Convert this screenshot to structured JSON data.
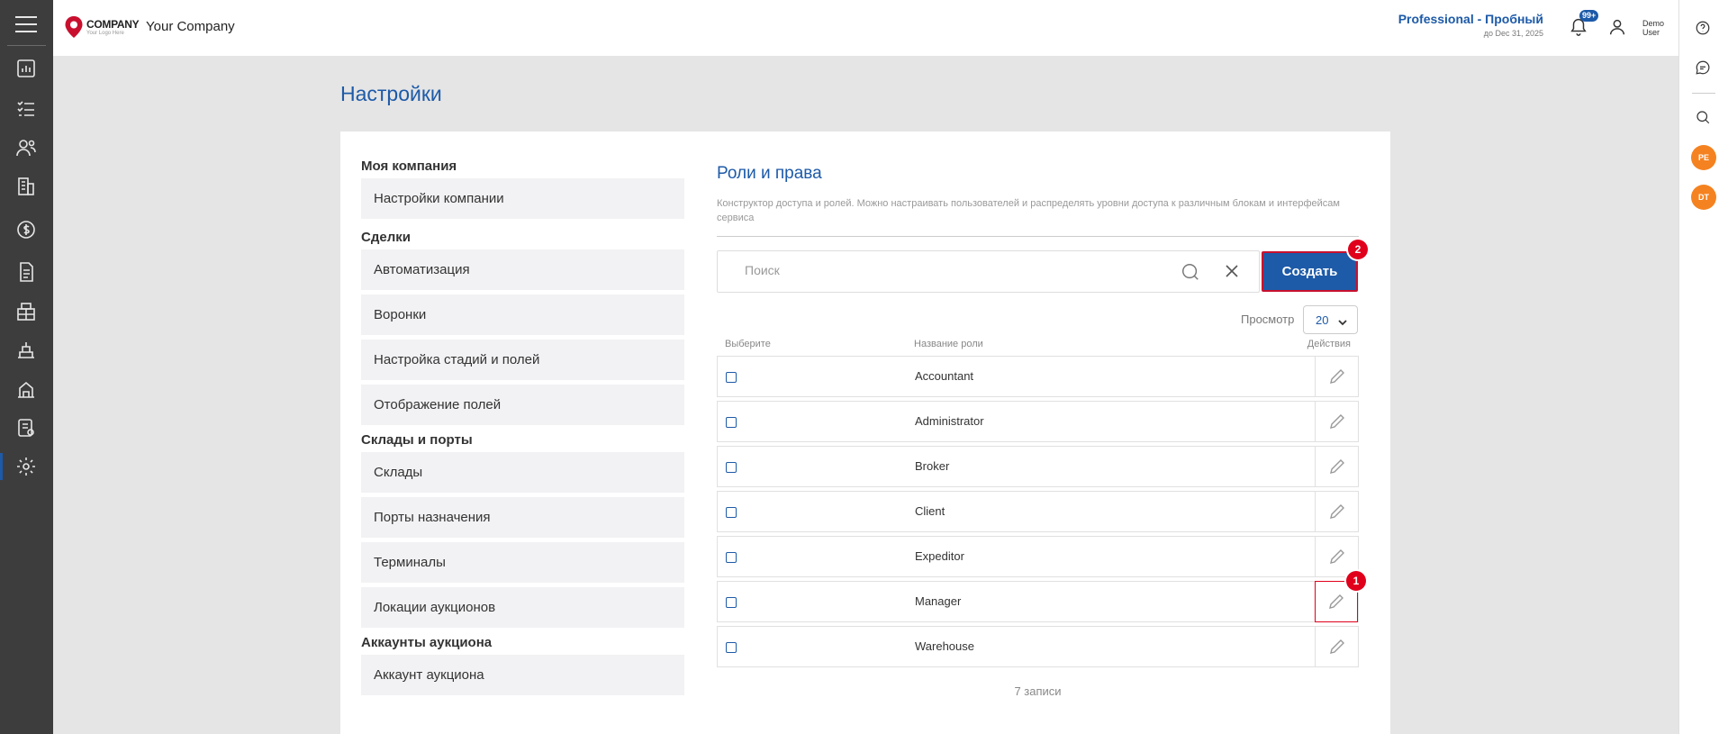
{
  "topbar": {
    "logo_main": "COMPANY",
    "logo_sub": "Your Logo Here",
    "company_name": "Your Company",
    "plan_title": "Professional - Пробный",
    "plan_sub": "до Dec 31, 2025",
    "notif_badge": "99+",
    "user_name": "Demo User"
  },
  "left_rail": {
    "icons": [
      "menu-icon",
      "dashboard-icon",
      "tasks-icon",
      "contacts-icon",
      "buildings-icon",
      "finance-icon",
      "documents-icon",
      "warehouse-icon",
      "terminal-icon",
      "auction-icon",
      "reports-icon",
      "settings-icon"
    ]
  },
  "right_rail": {
    "icons": [
      "help-icon",
      "chat-icon",
      "search-icon"
    ],
    "avatars": [
      "PE",
      "DT"
    ]
  },
  "page": {
    "title": "Настройки"
  },
  "menu": {
    "groups": [
      {
        "title": "Моя компания",
        "items": [
          "Настройки компании"
        ]
      },
      {
        "title": "Сделки",
        "items": [
          "Автоматизация",
          "Воронки",
          "Настройка стадий и полей",
          "Отображение полей"
        ]
      },
      {
        "title": "Склады и порты",
        "items": [
          "Склады",
          "Порты назначения",
          "Терминалы",
          "Локации аукционов"
        ]
      },
      {
        "title": "Аккаунты аукциона",
        "items": [
          "Аккаунт аукциона"
        ]
      }
    ]
  },
  "roles": {
    "title": "Роли и права",
    "description": "Конструктор доступа и ролей. Можно настраивать пользователей и распределять уровни доступа к различным блокам и интерфейсам сервиса",
    "search_placeholder": "Поиск",
    "create_label": "Создать",
    "create_marker": "2",
    "view_label": "Просмотр",
    "view_value": "20",
    "columns": {
      "select": "Выберите",
      "name": "Название роли",
      "actions": "Действия"
    },
    "rows": [
      "Accountant",
      "Administrator",
      "Broker",
      "Client",
      "Expeditor",
      "Manager",
      "Warehouse"
    ],
    "highlighted_row_marker": "1",
    "records": "7 записи"
  },
  "colors": {
    "brand_blue": "#1d5aa8",
    "marker_red": "#e0001b",
    "avatar_orange": "#f58220",
    "rail_dark": "#3d3d3d"
  }
}
